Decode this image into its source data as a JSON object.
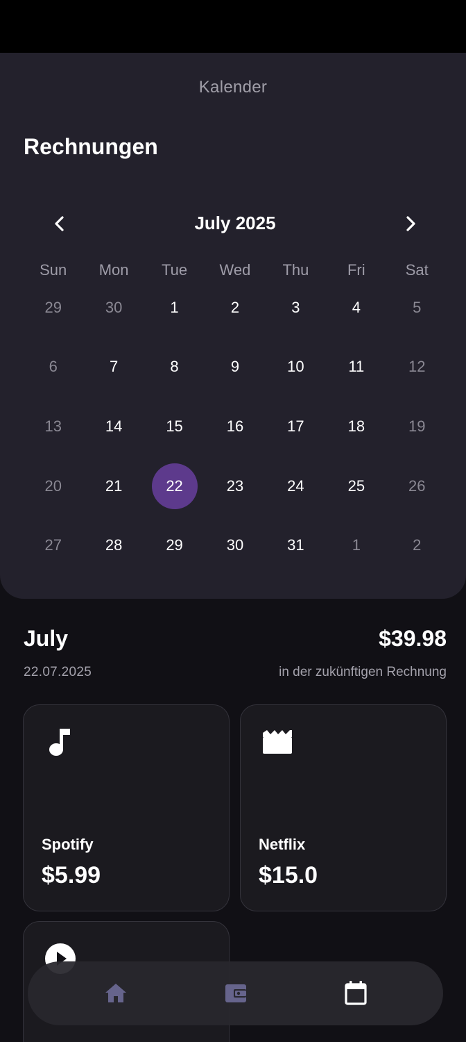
{
  "header": {
    "screen_title": "Kalender",
    "section_title": "Rechnungen"
  },
  "calendar": {
    "month_label": "July 2025",
    "prev_icon": "chevron-left-icon",
    "next_icon": "chevron-right-icon",
    "weekdays": [
      "Sun",
      "Mon",
      "Tue",
      "Wed",
      "Thu",
      "Fri",
      "Sat"
    ],
    "days": [
      {
        "label": "29",
        "muted": true
      },
      {
        "label": "30",
        "muted": true
      },
      {
        "label": "1"
      },
      {
        "label": "2"
      },
      {
        "label": "3"
      },
      {
        "label": "4"
      },
      {
        "label": "5",
        "muted": true
      },
      {
        "label": "6",
        "muted": true
      },
      {
        "label": "7"
      },
      {
        "label": "8"
      },
      {
        "label": "9"
      },
      {
        "label": "10"
      },
      {
        "label": "11"
      },
      {
        "label": "12",
        "muted": true
      },
      {
        "label": "13",
        "muted": true
      },
      {
        "label": "14"
      },
      {
        "label": "15"
      },
      {
        "label": "16"
      },
      {
        "label": "17"
      },
      {
        "label": "18"
      },
      {
        "label": "19",
        "muted": true
      },
      {
        "label": "20",
        "muted": true
      },
      {
        "label": "21"
      },
      {
        "label": "22",
        "selected": true
      },
      {
        "label": "23"
      },
      {
        "label": "24"
      },
      {
        "label": "25"
      },
      {
        "label": "26",
        "muted": true
      },
      {
        "label": "27",
        "muted": true
      },
      {
        "label": "28"
      },
      {
        "label": "29"
      },
      {
        "label": "30"
      },
      {
        "label": "31"
      },
      {
        "label": "1",
        "muted": true
      },
      {
        "label": "2",
        "muted": true
      }
    ],
    "selected_color": "#5d3a8c"
  },
  "summary": {
    "month": "July",
    "total": "$39.98",
    "date": "22.07.2025",
    "note": "in der zukünftigen Rechnung"
  },
  "bills": [
    {
      "name": "Spotify",
      "price": "$5.99",
      "icon": "music-note-icon"
    },
    {
      "name": "Netflix",
      "price": "$15.0",
      "icon": "movie-clapper-icon"
    },
    {
      "name": "",
      "price": "",
      "icon": "play-circle-icon"
    }
  ],
  "bottom_nav": {
    "items": [
      {
        "icon": "home-icon",
        "active": false
      },
      {
        "icon": "wallet-icon",
        "active": false
      },
      {
        "icon": "calendar-icon",
        "active": true
      }
    ],
    "inactive_color": "#66648c",
    "active_color": "#ffffff"
  }
}
